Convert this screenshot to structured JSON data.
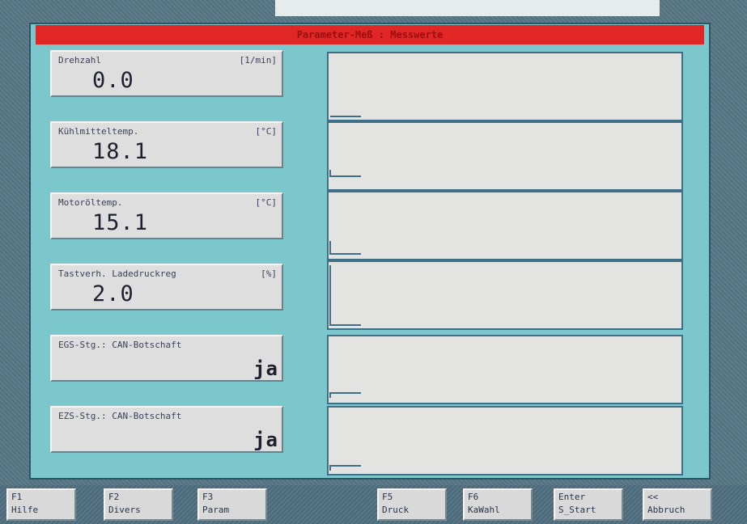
{
  "window": {
    "title": "Parameter-Meß : Messwerte"
  },
  "parameters": [
    {
      "label": "Drehzahl",
      "unit": "[1/min]",
      "value": "0.0"
    },
    {
      "label": "Kühlmitteltemp.",
      "unit": "[°C]",
      "value": "18.1"
    },
    {
      "label": "Motoröltemp.",
      "unit": "[°C]",
      "value": "15.1"
    },
    {
      "label": "Tastverh. Ladedruckreg",
      "unit": "[%]",
      "value": "2.0"
    },
    {
      "label": "EGS-Stg.: CAN-Botschaft",
      "unit": "",
      "value": "ja"
    },
    {
      "label": "EZS-Stg.: CAN-Botschaft",
      "unit": "",
      "value": "ja"
    }
  ],
  "function_keys": [
    {
      "key": "F1",
      "label": "Hilfe"
    },
    {
      "key": "F2",
      "label": "Divers"
    },
    {
      "key": "F3",
      "label": "Param"
    },
    {
      "key": "F5",
      "label": "Druck"
    },
    {
      "key": "F6",
      "label": "KaWahl"
    },
    {
      "key": "Enter",
      "label": "S_Start"
    },
    {
      "key": "<<",
      "label": "Abbruch"
    }
  ],
  "colors": {
    "title_bar": "#e12626",
    "panel": "#7cc7cc",
    "graph_line": "#3e6f86"
  }
}
